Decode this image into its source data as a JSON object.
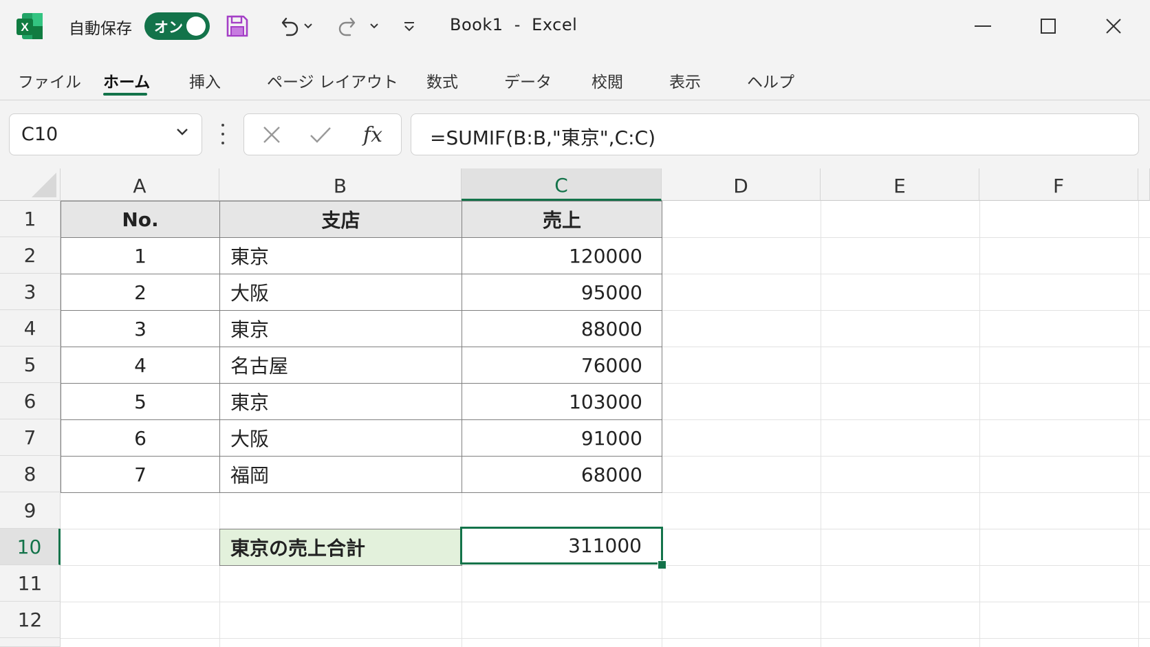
{
  "titlebar": {
    "app_icon": "excel-icon",
    "app_icon_letter": "X",
    "autosave_label": "自動保存",
    "autosave_state": "オン",
    "window_title": "Book1  -  Excel",
    "icons": [
      "save-icon",
      "undo-icon",
      "redo-icon",
      "customize-qat-icon",
      "minimize-icon",
      "maximize-icon",
      "close-icon"
    ]
  },
  "ribbon": {
    "tabs": [
      "ファイル",
      "ホーム",
      "挿入",
      "ページ レイアウト",
      "数式",
      "データ",
      "校閲",
      "表示",
      "ヘルプ"
    ],
    "active_tab": "ホーム"
  },
  "formula_bar": {
    "name_box": "C10",
    "fx_label": "fx",
    "formula": "=SUMIF(B:B,\"東京\",C:C)"
  },
  "sheet": {
    "columns": [
      "A",
      "B",
      "C",
      "D",
      "E",
      "F"
    ],
    "selected_column": "C",
    "rows": [
      "1",
      "2",
      "3",
      "4",
      "5",
      "6",
      "7",
      "8",
      "9",
      "10",
      "11",
      "12"
    ],
    "selected_row": "10",
    "table_headers": [
      "No.",
      "支店",
      "売上"
    ],
    "table_rows": [
      [
        "1",
        "東京",
        "120000"
      ],
      [
        "2",
        "大阪",
        "95000"
      ],
      [
        "3",
        "東京",
        "88000"
      ],
      [
        "4",
        "名古屋",
        "76000"
      ],
      [
        "5",
        "東京",
        "103000"
      ],
      [
        "6",
        "大阪",
        "91000"
      ],
      [
        "7",
        "福岡",
        "68000"
      ]
    ],
    "summary_label": "東京の売上合計",
    "summary_value": "311000"
  },
  "colors": {
    "accent": "#13734a",
    "header_fill": "#e6e6e6",
    "label_fill": "#e3f1dc"
  }
}
